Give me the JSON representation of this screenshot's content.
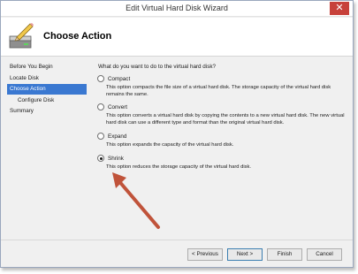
{
  "window": {
    "title": "Edit Virtual Hard Disk Wizard",
    "close_glyph": "✕"
  },
  "header": {
    "title": "Choose Action",
    "icon": "disk-pencil-icon"
  },
  "nav": {
    "items": [
      {
        "label": "Before You Begin",
        "active": false
      },
      {
        "label": "Locate Disk",
        "active": false
      },
      {
        "label": "Choose Action",
        "active": true
      },
      {
        "label": "Configure Disk",
        "active": false
      },
      {
        "label": "Summary",
        "active": false
      }
    ]
  },
  "content": {
    "question": "What do you want to do to the virtual hard disk?",
    "options": [
      {
        "label": "Compact",
        "selected": false,
        "description": "This option compacts the file size of a virtual hard disk. The storage capacity of the virtual hard disk remains the same."
      },
      {
        "label": "Convert",
        "selected": false,
        "description": "This option converts a virtual hard disk by copying the contents to a new virtual hard disk. The new virtual hard disk can use a different type and format than the original virtual hard disk."
      },
      {
        "label": "Expand",
        "selected": false,
        "description": "This option expands the capacity of the virtual hard disk."
      },
      {
        "label": "Shrink",
        "selected": true,
        "description": "This option reduces the storage capacity of the virtual hard disk."
      }
    ]
  },
  "footer": {
    "previous": "< Previous",
    "next": "Next >",
    "finish": "Finish",
    "cancel": "Cancel"
  },
  "colors": {
    "accent": "#3a78d1",
    "annotation_arrow": "#c0533a",
    "close_button": "#c7413a"
  }
}
